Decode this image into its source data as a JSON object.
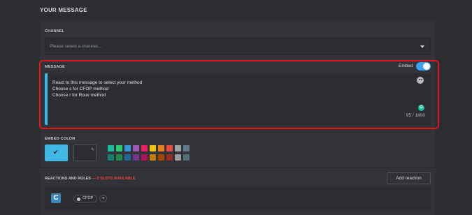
{
  "section": {
    "title": "YOUR MESSAGE"
  },
  "channel": {
    "label": "CHANNEL",
    "placeholder": "Please select a channel..."
  },
  "message": {
    "label": "MESSAGE",
    "embed_label": "Embed",
    "embed_enabled": true,
    "lines": [
      "React to this message to select your method",
      "Choose c for CFOP method",
      "Choose r for Roux method"
    ],
    "counter": "95 / 1800",
    "grammarly_icon": "G"
  },
  "embed_color": {
    "label": "EMBED COLOR",
    "selected": "#3fb8e3",
    "swatches": [
      "#1abc9c",
      "#2ecc71",
      "#3498db",
      "#9b59b6",
      "#e91e63",
      "#f1c40f",
      "#e67e22",
      "#e74c3c",
      "#95a5a6",
      "#607d8b",
      "#11806a",
      "#1f8b4c",
      "#206694",
      "#71368a",
      "#ad1457",
      "#c27c0e",
      "#a84300",
      "#992d22",
      "#979c9f",
      "#546e7a"
    ]
  },
  "reactions": {
    "label": "REACTIONS AND ROLES",
    "slots_text": "— 0 SLOTS AVAILABLE",
    "add_button": "Add reaction",
    "items": [
      {
        "emoji_letter": "C",
        "role": "CFOP",
        "add_role": "+"
      }
    ]
  },
  "colors": {
    "accent": "#3ba3f5",
    "highlight": "#e0161b",
    "danger": "#ed4245"
  }
}
